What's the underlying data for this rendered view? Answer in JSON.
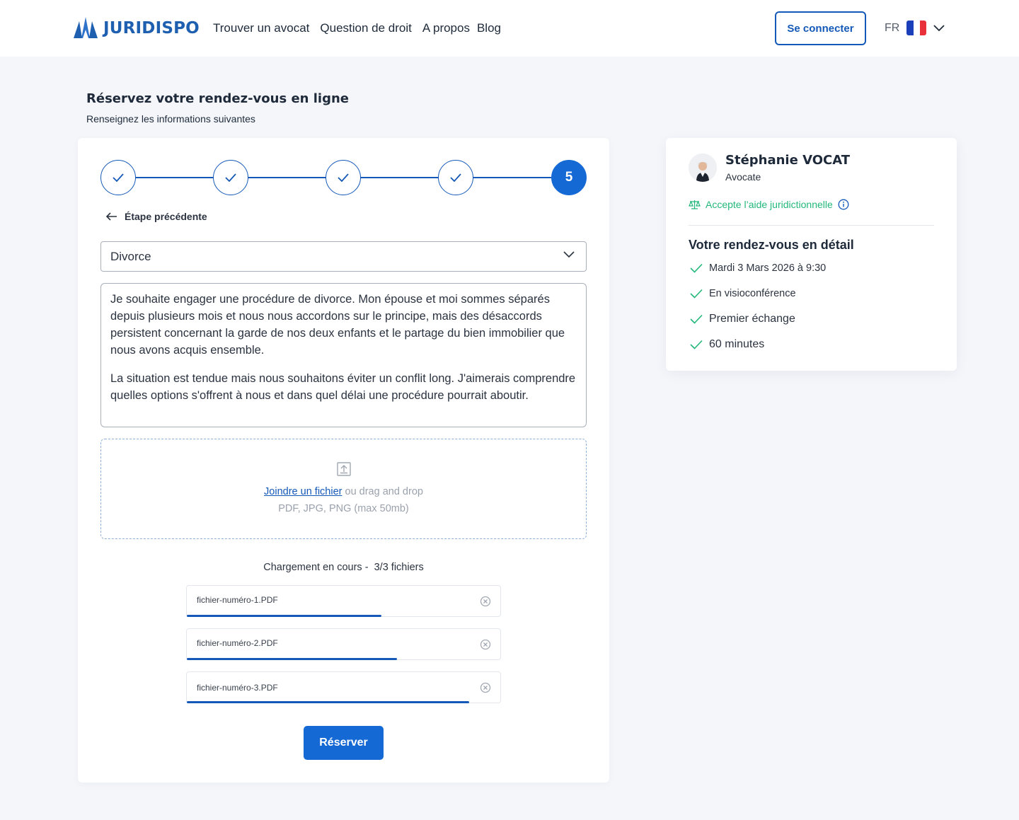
{
  "header": {
    "brand": "JURIDISPO",
    "nav": [
      "Trouver un avocat",
      "Question de droit",
      "A propos",
      "Blog"
    ],
    "login_label": "Se connecter",
    "lang_code": "FR",
    "flag_colors": [
      "#1a3fb8",
      "#ffffff",
      "#e8313a"
    ]
  },
  "page": {
    "title": "Réservez votre rendez-vous en ligne",
    "subtitle": "Renseignez les informations suivantes"
  },
  "stepper": {
    "steps": [
      {
        "state": "done",
        "icon": "check-icon"
      },
      {
        "state": "done",
        "icon": "check-icon"
      },
      {
        "state": "done",
        "icon": "check-icon"
      },
      {
        "state": "done",
        "icon": "check-icon"
      },
      {
        "state": "active",
        "label": "5"
      }
    ]
  },
  "form": {
    "back_label": "Étape précédente",
    "category_value": "Divorce",
    "message_paragraphs": [
      "Je souhaite engager une procédure de divorce. Mon épouse et moi sommes séparés depuis plusieurs mois et nous nous accordons sur le principe, mais des désaccords persistent concernant la garde de nos deux enfants et le partage du bien immobilier que nous avons acquis ensemble.",
      "La situation est tendue mais nous souhaitons éviter un conflit long. J'aimerais comprendre quelles options s'offrent à nous et dans quel délai une procédure pourrait aboutir."
    ],
    "dropzone": {
      "link_label": "Joindre un fichier",
      "hint": "ou drag and drop",
      "formats": "PDF, JPG, PNG (max 50mb)"
    },
    "upload_status_prefix": "Chargement en cours -",
    "upload_status_count": "3/3 fichiers",
    "files": [
      {
        "name": "fichier-numéro-1.PDF",
        "progress": 0.62
      },
      {
        "name": "fichier-numéro-2.PDF",
        "progress": 0.67
      },
      {
        "name": "fichier-numéro-3.PDF",
        "progress": 0.9
      }
    ],
    "submit_label": "Réserver"
  },
  "lawyer": {
    "name": "Stéphanie VOCAT",
    "role": "Avocate",
    "aid_label": "Accepte l’aide juridictionnelle",
    "details_title": "Votre rendez-vous en détail",
    "details": [
      "Mardi 3 Mars 2026 à 9:30",
      "En visioconférence",
      "Premier échange",
      "60 minutes"
    ]
  },
  "colors": {
    "primary": "#1569d4",
    "primary_dark": "#1559b8",
    "success": "#22b87a",
    "background": "#f4f6fa"
  }
}
